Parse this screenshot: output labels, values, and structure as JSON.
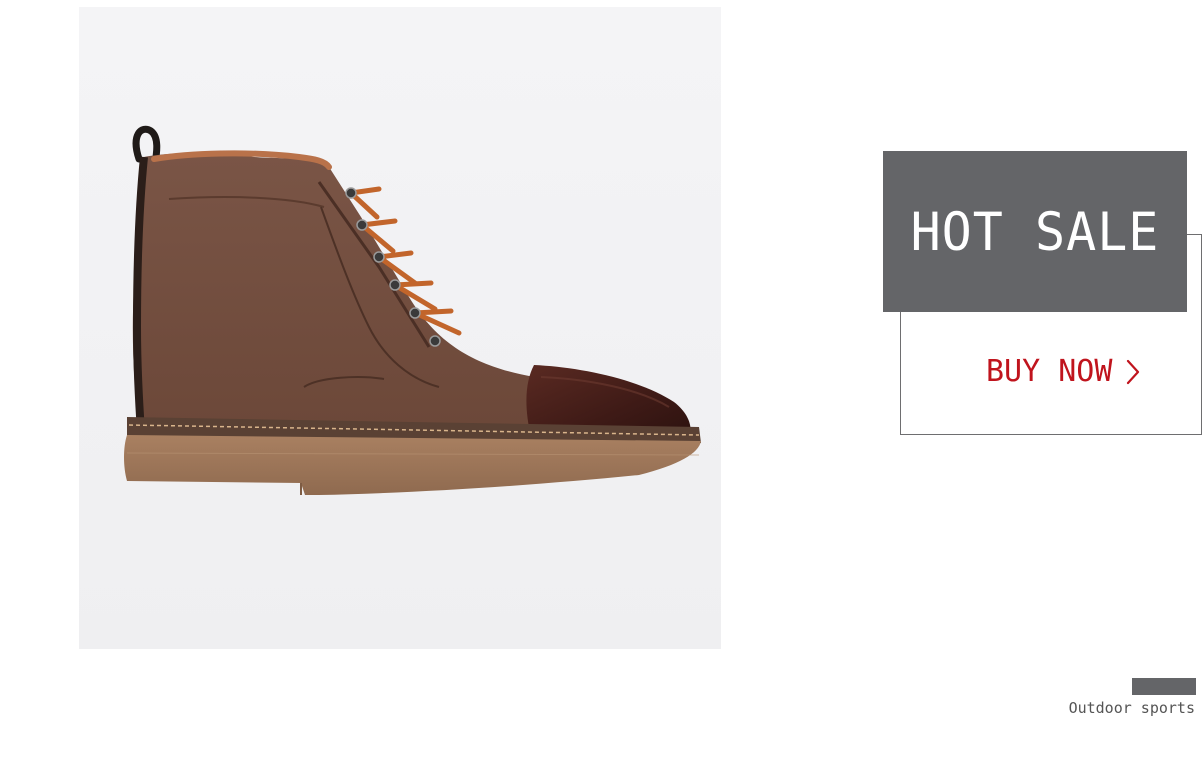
{
  "promo": {
    "title": "HOT SALE",
    "cta_label": "BUY NOW",
    "cta_icon": "chevron-right-icon",
    "cta_color": "#c0141d",
    "panel_color": "#646568"
  },
  "product": {
    "image_alt": "brown canvas lace-up boot"
  },
  "category": {
    "caption": "Outdoor sports"
  }
}
